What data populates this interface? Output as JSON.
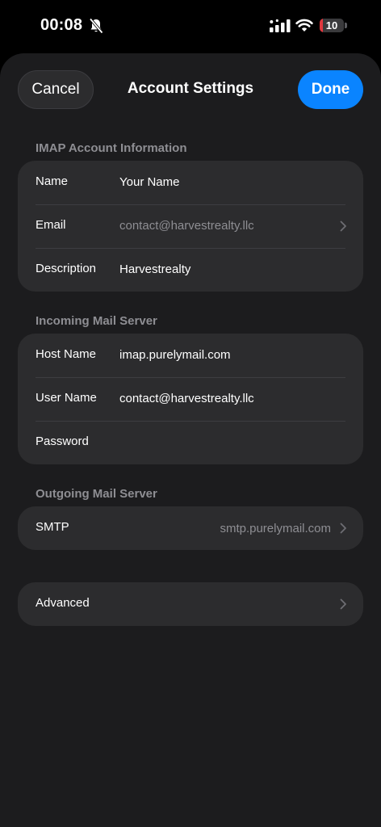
{
  "status_bar": {
    "time": "00:08",
    "battery_level": "10",
    "battery_fraction": 0.1,
    "icons": [
      "bell-slash-icon",
      "cellular-signal-icon",
      "wifi-icon",
      "battery-icon"
    ]
  },
  "nav": {
    "cancel_label": "Cancel",
    "title": "Account Settings",
    "done_label": "Done"
  },
  "sections": {
    "imap": {
      "header": "IMAP Account Information",
      "rows": [
        {
          "label": "Name",
          "value": "Your Name"
        },
        {
          "label": "Email",
          "value": "contact@harvestrealty.llc"
        },
        {
          "label": "Description",
          "value": "Harvestrealty"
        }
      ]
    },
    "incoming": {
      "header": "Incoming Mail Server",
      "rows": [
        {
          "label": "Host Name",
          "value": "imap.purelymail.com"
        },
        {
          "label": "User Name",
          "value": "contact@harvestrealty.llc"
        },
        {
          "label": "Password",
          "value": ""
        }
      ]
    },
    "outgoing": {
      "header": "Outgoing Mail Server",
      "rows": [
        {
          "label": "SMTP",
          "value": "smtp.purelymail.com"
        }
      ]
    },
    "advanced": {
      "label": "Advanced"
    }
  },
  "colors": {
    "background": "#000000",
    "sheet": "#1c1c1e",
    "cell": "#2c2c2e",
    "accent": "#0a84ff",
    "secondary_text": "#8e8e93",
    "battery_low": "#e0383e"
  }
}
